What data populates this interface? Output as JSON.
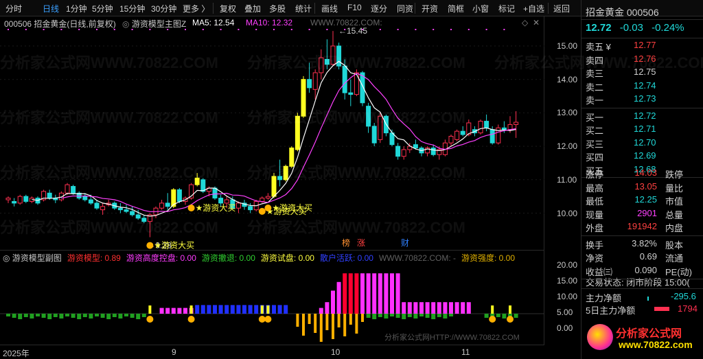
{
  "toolbar": {
    "items": [
      "分时",
      "日线",
      "1分钟",
      "5分钟",
      "15分钟",
      "30分钟",
      "更多 〉",
      "复权",
      "叠加",
      "多股",
      "统计",
      "画线",
      "F10",
      "逐分",
      "同资",
      "开资",
      "简框",
      "小窗",
      "标记",
      "+自选",
      "返回"
    ]
  },
  "main_header": {
    "stock": "000506 招金黄金(日线,前复权)",
    "indicator": "游资模型主图Z",
    "ma5_label": "MA5: 12.54",
    "ma10_label": "MA10: 12.32",
    "watermark_site": "WWW.70822.COM:"
  },
  "price_axis": [
    "15.00",
    "14.00",
    "13.00",
    "12.00",
    "11.00",
    "10.00"
  ],
  "annotations": {
    "high": "15.45",
    "low": "9.28",
    "buy_signal": "游资大买",
    "badges": [
      "榜",
      "涨",
      "财"
    ]
  },
  "sub_header": {
    "name": "游资模型副图",
    "items": [
      {
        "label": "游资模型: 0.89",
        "color": "#ff3030"
      },
      {
        "label": "游资高度控盘: 0.00",
        "color": "#ff3cff"
      },
      {
        "label": "游资撤退: 0.00",
        "color": "#30d030"
      },
      {
        "label": "游资试盘: 0.00",
        "color": "#ffff40"
      },
      {
        "label": "散户活跃: 0.00",
        "color": "#3040ff"
      },
      {
        "label": "WWW.70822.COM: -",
        "color": "#606060"
      },
      {
        "label": "游资强度: 0.00",
        "color": "#e0b000"
      }
    ]
  },
  "sub_axis": [
    "20.00",
    "15.00",
    "10.00",
    "5.00",
    "0.00"
  ],
  "x_axis": [
    "2025年",
    "9",
    "10",
    "11"
  ],
  "watermark": "分析家公式网WWW.70822.COM",
  "bottom_watermark": "分析家公式网HTTP://WWW.70822.COM",
  "quote": {
    "name_code": "招金黄金 000506",
    "price": "12.72",
    "change": "-0.03",
    "pct": "-0.24%",
    "asks": [
      {
        "label": "卖五 ¥",
        "price": "12.77",
        "color": "#ff4040"
      },
      {
        "label": "卖四",
        "price": "12.76",
        "color": "#ff4040"
      },
      {
        "label": "卖三",
        "price": "12.75",
        "color": "#d0d0d0"
      },
      {
        "label": "卖二",
        "price": "12.74",
        "color": "#20d8d8"
      },
      {
        "label": "卖一",
        "price": "12.73",
        "color": "#20d8d8"
      }
    ],
    "bids": [
      {
        "label": "买一",
        "price": "12.72",
        "color": "#20d8d8"
      },
      {
        "label": "买二",
        "price": "12.71",
        "color": "#20d8d8"
      },
      {
        "label": "买三",
        "price": "12.70",
        "color": "#20d8d8"
      },
      {
        "label": "买四",
        "price": "12.69",
        "color": "#20d8d8"
      },
      {
        "label": "买五",
        "price": "12.68",
        "color": "#20d8d8"
      }
    ],
    "stats": [
      {
        "l": "涨停",
        "v": "14.03",
        "c": "#ff4040",
        "r": "跌停"
      },
      {
        "l": "最高",
        "v": "13.05",
        "c": "#ff4040",
        "r": "量比"
      },
      {
        "l": "最低",
        "v": "12.25",
        "c": "#20d8d8",
        "r": "市值"
      },
      {
        "l": "现量",
        "v": "2901",
        "c": "#ff40ff",
        "r": "总量"
      },
      {
        "l": "外盘",
        "v": "191942",
        "c": "#ff4040",
        "r": "内盘"
      }
    ],
    "stats2": [
      {
        "l": "换手",
        "v": "3.82%",
        "r": "股本"
      },
      {
        "l": "净资",
        "v": "0.69",
        "r": "流通"
      },
      {
        "l": "收益㈢",
        "v": "0.090",
        "r": "PE(动)"
      }
    ],
    "trade_state": "交易状态: 闭市阶段 15:00(",
    "flow1_label": "主力净额",
    "flow1_value": "-295.6",
    "flow2_label": "5日主力净额",
    "flow2_value": "1794"
  },
  "logo": {
    "text": "分析家公式网",
    "url": "www.70822.com"
  },
  "chart_data": {
    "type": "candlestick",
    "candles": [
      [
        10.4,
        10.5,
        10.3,
        10.45
      ],
      [
        10.35,
        10.45,
        10.2,
        10.3
      ],
      [
        10.3,
        10.55,
        10.25,
        10.5
      ],
      [
        10.5,
        10.55,
        10.3,
        10.35
      ],
      [
        10.35,
        10.5,
        10.3,
        10.45
      ],
      [
        10.45,
        10.5,
        10.25,
        10.3
      ],
      [
        10.4,
        10.7,
        10.35,
        10.65
      ],
      [
        10.6,
        10.7,
        10.4,
        10.45
      ],
      [
        10.45,
        10.55,
        10.3,
        10.4
      ],
      [
        10.4,
        10.65,
        10.35,
        10.6
      ],
      [
        10.6,
        10.9,
        10.55,
        10.85
      ],
      [
        10.8,
        10.85,
        10.55,
        10.6
      ],
      [
        10.6,
        10.65,
        10.4,
        10.45
      ],
      [
        10.5,
        10.6,
        10.35,
        10.4
      ],
      [
        10.4,
        10.55,
        10.25,
        10.3
      ],
      [
        10.3,
        10.4,
        10.1,
        10.15
      ],
      [
        10.1,
        10.3,
        9.95,
        10.2
      ],
      [
        10.25,
        10.4,
        10.2,
        10.3
      ],
      [
        10.3,
        10.35,
        10.1,
        10.15
      ],
      [
        10.15,
        10.3,
        10.0,
        10.1
      ],
      [
        10.1,
        10.25,
        10.0,
        10.05
      ],
      [
        10.05,
        10.2,
        9.9,
        9.95
      ],
      [
        9.95,
        10.1,
        9.8,
        9.85
      ],
      [
        9.85,
        9.95,
        9.7,
        9.75
      ],
      [
        9.75,
        10.0,
        9.28,
        9.95
      ],
      [
        9.95,
        10.2,
        9.85,
        10.15
      ],
      [
        10.15,
        10.4,
        10.1,
        10.3
      ],
      [
        10.3,
        10.6,
        10.1,
        10.2
      ],
      [
        10.2,
        10.75,
        10.15,
        10.7
      ],
      [
        10.7,
        10.75,
        10.3,
        10.35
      ],
      [
        10.35,
        10.5,
        10.25,
        10.45
      ],
      [
        10.45,
        10.9,
        10.4,
        10.85
      ],
      [
        10.85,
        11.2,
        10.8,
        11.05
      ],
      [
        11.0,
        11.05,
        10.6,
        10.65
      ],
      [
        10.65,
        10.8,
        10.5,
        10.75
      ],
      [
        10.75,
        10.8,
        10.4,
        10.45
      ],
      [
        10.45,
        10.55,
        10.2,
        10.3
      ],
      [
        10.3,
        10.5,
        10.15,
        10.4
      ],
      [
        10.4,
        10.5,
        10.1,
        10.15
      ],
      [
        10.15,
        10.35,
        10.0,
        10.3
      ],
      [
        10.3,
        10.4,
        10.1,
        10.2
      ],
      [
        10.2,
        10.3,
        10.0,
        10.1
      ],
      [
        10.1,
        10.4,
        10.05,
        10.35
      ],
      [
        10.35,
        10.5,
        10.3,
        10.45
      ],
      [
        10.45,
        10.6,
        10.4,
        10.5
      ],
      [
        10.5,
        11.2,
        10.45,
        11.1
      ],
      [
        11.1,
        11.6,
        10.8,
        11.0
      ],
      [
        11.0,
        11.45,
        10.95,
        11.4
      ],
      [
        11.4,
        12.0,
        11.35,
        11.95
      ],
      [
        11.9,
        13.0,
        11.85,
        12.9
      ],
      [
        12.9,
        14.1,
        12.85,
        14.0
      ],
      [
        14.0,
        14.5,
        13.6,
        13.75
      ],
      [
        13.7,
        14.3,
        13.4,
        14.2
      ],
      [
        14.2,
        14.9,
        14.0,
        14.65
      ],
      [
        14.6,
        15.2,
        14.3,
        14.45
      ],
      [
        14.45,
        15.45,
        14.4,
        15.0
      ],
      [
        15.0,
        15.1,
        14.3,
        14.4
      ],
      [
        14.4,
        14.6,
        13.4,
        13.6
      ],
      [
        13.6,
        14.0,
        13.2,
        13.55
      ],
      [
        13.55,
        14.3,
        13.5,
        14.2
      ],
      [
        14.2,
        14.25,
        13.2,
        13.3
      ],
      [
        13.2,
        13.3,
        12.4,
        12.6
      ],
      [
        12.6,
        12.7,
        12.0,
        12.1
      ],
      [
        12.2,
        13.0,
        12.1,
        12.9
      ],
      [
        12.9,
        12.95,
        12.3,
        12.4
      ],
      [
        12.4,
        12.5,
        12.0,
        12.05
      ],
      [
        12.0,
        12.1,
        11.6,
        11.7
      ],
      [
        11.7,
        12.0,
        11.6,
        11.9
      ],
      [
        11.9,
        12.1,
        11.8,
        12.0
      ],
      [
        12.05,
        12.2,
        11.9,
        11.95
      ],
      [
        11.95,
        12.0,
        11.7,
        11.8
      ],
      [
        11.8,
        12.0,
        11.7,
        11.95
      ],
      [
        11.95,
        12.05,
        11.7,
        11.75
      ],
      [
        11.75,
        12.0,
        11.6,
        11.9
      ],
      [
        11.75,
        12.2,
        11.7,
        12.1
      ],
      [
        12.1,
        12.35,
        12.0,
        12.3
      ],
      [
        12.2,
        12.5,
        12.15,
        12.45
      ],
      [
        12.45,
        12.6,
        12.3,
        12.35
      ],
      [
        12.35,
        12.8,
        12.3,
        12.7
      ],
      [
        12.5,
        12.6,
        12.3,
        12.4
      ],
      [
        12.4,
        12.8,
        12.35,
        12.75
      ],
      [
        12.75,
        12.95,
        12.45,
        12.55
      ],
      [
        12.5,
        12.6,
        12.05,
        12.1
      ],
      [
        12.1,
        12.65,
        12.05,
        12.55
      ],
      [
        12.55,
        12.75,
        12.4,
        12.5
      ],
      [
        12.5,
        12.9,
        12.4,
        12.65
      ],
      [
        12.65,
        13.05,
        12.25,
        12.72
      ]
    ],
    "ma5_values": "MA5: 12.54",
    "ma10_values": "MA10: 12.32",
    "buy_signal_days": [
      24,
      31,
      43,
      44
    ],
    "sub_values": [
      0,
      0,
      0,
      0,
      0,
      0,
      0,
      0,
      0,
      0,
      0,
      0,
      0,
      0,
      0,
      0,
      0,
      0,
      0,
      0,
      0,
      0,
      0,
      0,
      0,
      0,
      2,
      2,
      2,
      2,
      2,
      2,
      3,
      3,
      3,
      3,
      3,
      3,
      3,
      3,
      3,
      3,
      3,
      3,
      3,
      3,
      3,
      3,
      0,
      0,
      0,
      0,
      0,
      2,
      4,
      8,
      11,
      14,
      14,
      14,
      14,
      14,
      14,
      14,
      14,
      14,
      14,
      4,
      4,
      4,
      4,
      4,
      4,
      4,
      4,
      4,
      4,
      4,
      4,
      0,
      0,
      0,
      0,
      0,
      0,
      0,
      0,
      0,
      0,
      0,
      0,
      0,
      0,
      0,
      0,
      0,
      0,
      0,
      0,
      0,
      0,
      0,
      0,
      0,
      0,
      0,
      0,
      0,
      0
    ],
    "sub_ylim": [
      0,
      20
    ]
  }
}
